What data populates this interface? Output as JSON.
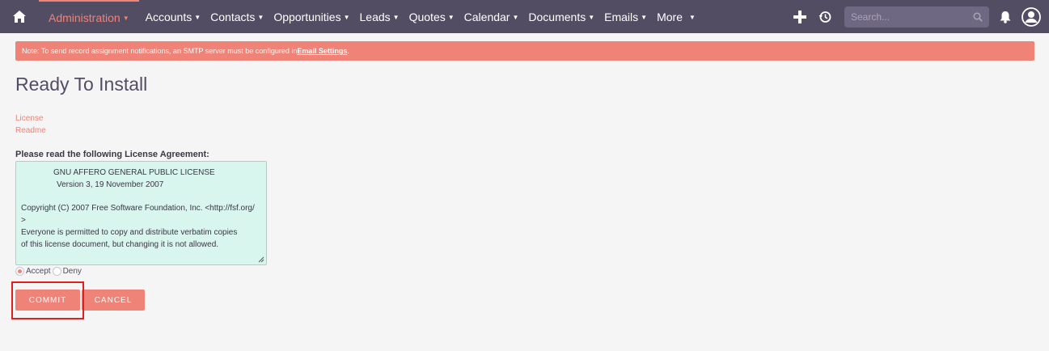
{
  "nav": {
    "items": [
      {
        "label": "Administration",
        "active": true
      },
      {
        "label": "Accounts"
      },
      {
        "label": "Contacts"
      },
      {
        "label": "Opportunities"
      },
      {
        "label": "Leads"
      },
      {
        "label": "Quotes"
      },
      {
        "label": "Calendar"
      },
      {
        "label": "Documents"
      },
      {
        "label": "Emails"
      },
      {
        "label": "More"
      }
    ],
    "search_placeholder": "Search...",
    "icons": [
      "home-icon",
      "plus-icon",
      "history-icon",
      "search-icon",
      "bell-icon",
      "user-icon"
    ]
  },
  "alert": {
    "text": "Note: To send record assignment notifications, an SMTP server must be configured in ",
    "link": "Email Settings",
    "end": "."
  },
  "page": {
    "title": "Ready To Install",
    "links": [
      "License",
      "Readme"
    ],
    "agreement_label": "Please read the following License Agreement:",
    "license_lines": [
      "GNU AFFERO GENERAL PUBLIC LICENSE",
      "Version 3, 19 November 2007",
      "Copyright (C) 2007 Free Software Foundation, Inc. <http://fsf.org/",
      ">",
      "Everyone is permitted to copy and distribute verbatim copies",
      "of this license document, but changing it is not allowed."
    ],
    "radio_accept": "Accept",
    "radio_deny": "Deny",
    "accept_selected": true,
    "commit_label": "COMMIT",
    "cancel_label": "CANCEL"
  },
  "colors": {
    "nav_bg": "#534d64",
    "accent": "#f08377",
    "license_bg": "#d8f5ee",
    "highlight": "#e01f1f"
  }
}
